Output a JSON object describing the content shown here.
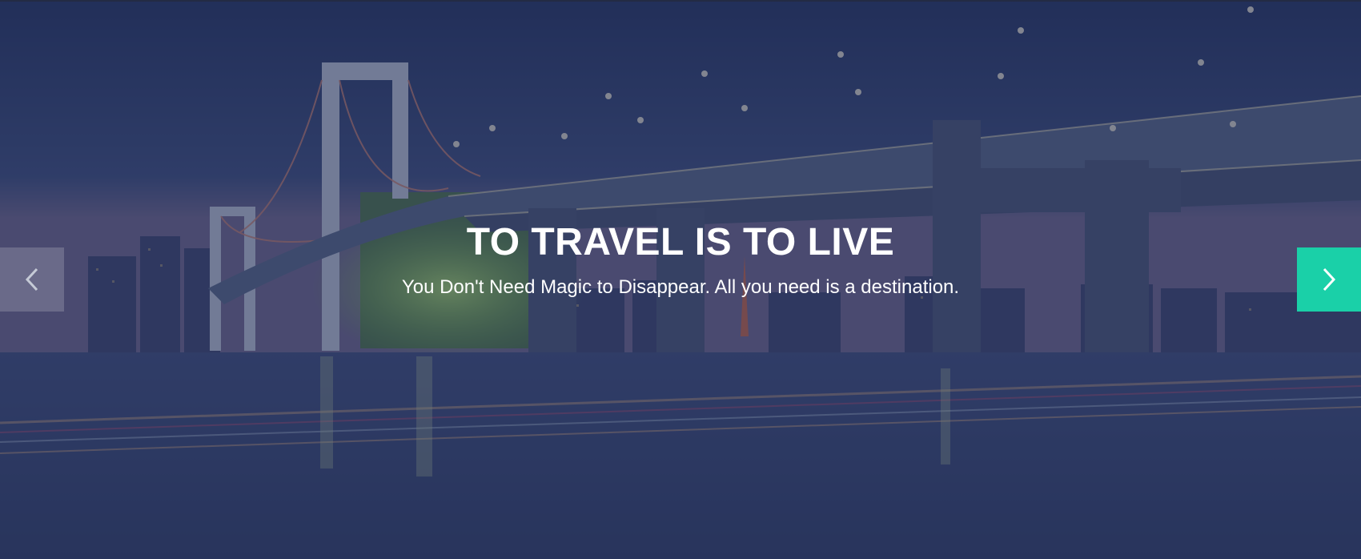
{
  "hero": {
    "title": "TO TRAVEL IS TO LIVE",
    "subtitle": "You Don't Need Magic to Disappear. All you need is a destination."
  },
  "controls": {
    "prev_icon": "chevron-left-icon",
    "next_icon": "chevron-right-icon"
  },
  "colors": {
    "overlay": "#28345c",
    "accent": "#1ad0a8",
    "text": "#ffffff"
  }
}
